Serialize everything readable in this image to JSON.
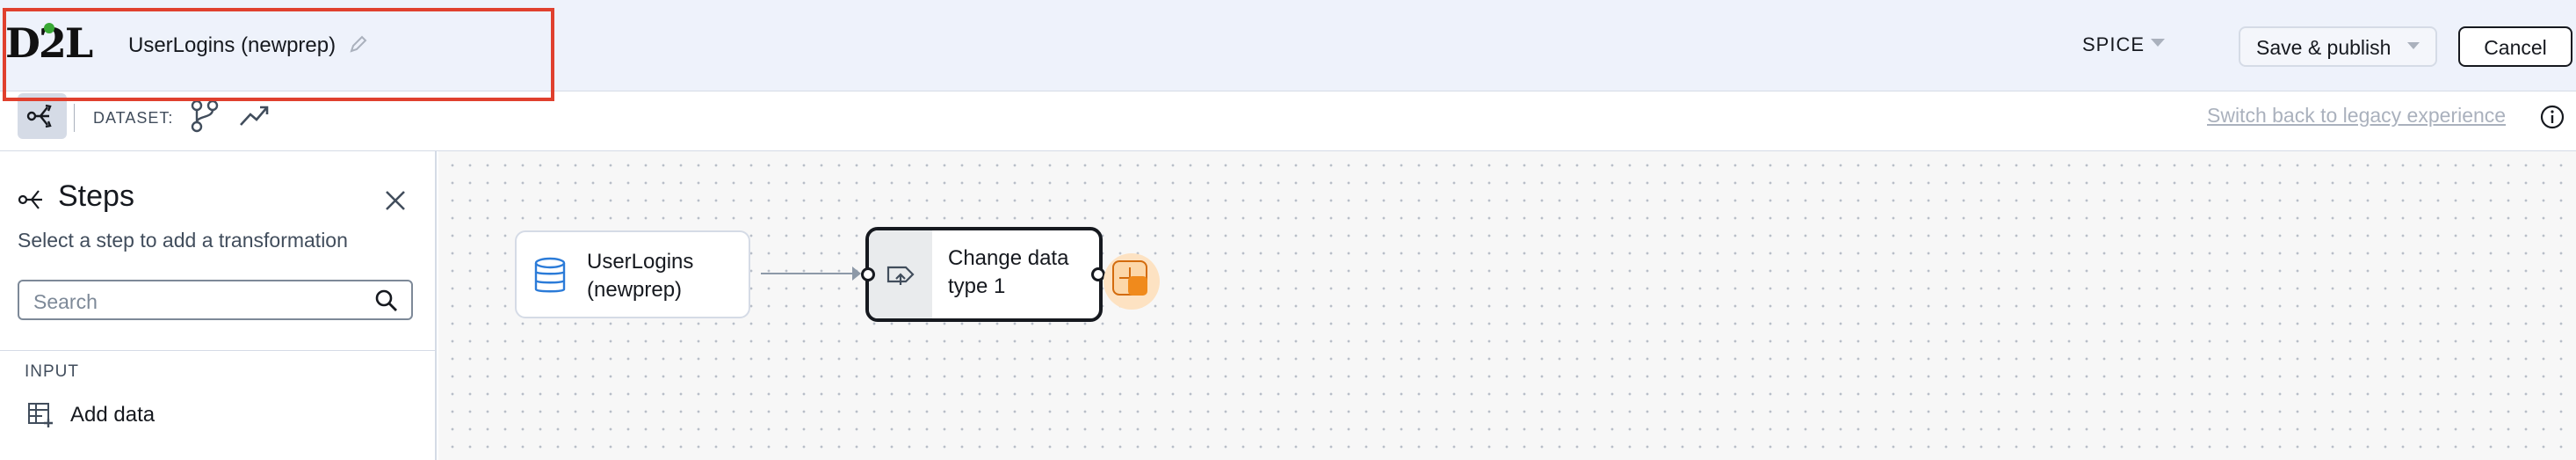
{
  "header": {
    "logo_text": "D2L",
    "dataset_title": "UserLogins (newprep)",
    "query_mode": "SPICE",
    "save_publish_label": "Save & publish",
    "cancel_label": "Cancel"
  },
  "toolbar": {
    "dataset_label": "DATASET:",
    "legacy_link": "Switch back to legacy experience"
  },
  "sidebar": {
    "title": "Steps",
    "subtitle": "Select a step to add a transformation",
    "search_placeholder": "Search",
    "section_input": "INPUT",
    "add_data_label": "Add data"
  },
  "canvas": {
    "source_node": {
      "label": "UserLogins (newprep)",
      "icon": "database-icon"
    },
    "transform_node": {
      "label": "Change data type 1",
      "icon": "change-type-icon"
    }
  },
  "colors": {
    "highlight": "#e0402e",
    "add_step": "#f08a1c",
    "header_bg": "#eef2fb"
  }
}
